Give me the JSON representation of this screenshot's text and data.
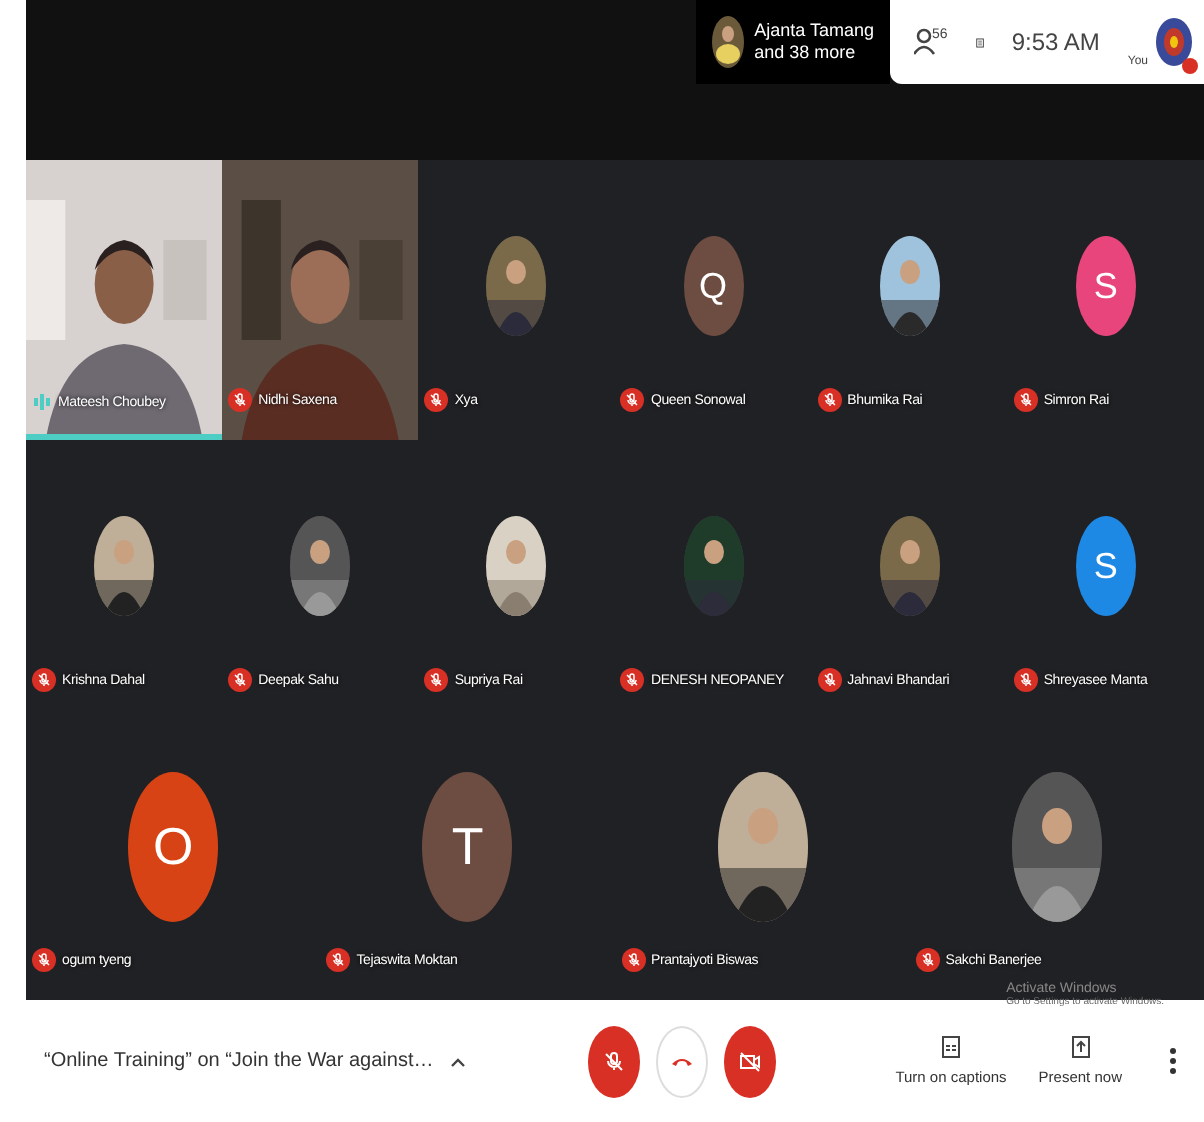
{
  "top_bar": {
    "presenter": {
      "name": "Ajanta Tamang",
      "more": "and 38 more"
    },
    "people_count": "56",
    "time": "9:53 AM",
    "self_label": "You",
    "self_muted": true
  },
  "rows": [
    [
      {
        "name": "Mateesh Choubey",
        "kind": "video",
        "muted": false,
        "speaking": true
      },
      {
        "name": "Nidhi Saxena",
        "kind": "video",
        "muted": true,
        "speaking": false
      },
      {
        "name": "Xya",
        "muted": true,
        "speaking": false
      },
      {
        "name": "Queen Sonowal",
        "kind": "letter",
        "letter": "Q",
        "color": "#6d4c41",
        "muted": true,
        "speaking": false
      },
      {
        "name": "Bhumika Rai",
        "muted": true,
        "speaking": false
      },
      {
        "name": "Simron Rai",
        "kind": "letter",
        "letter": "S",
        "color": "#e8457c",
        "muted": true,
        "speaking": false
      }
    ],
    [
      {
        "name": "Krishna Dahal",
        "muted": true,
        "speaking": false
      },
      {
        "name": "Deepak Sahu",
        "muted": true,
        "speaking": false
      },
      {
        "name": "Supriya Rai",
        "muted": true,
        "speaking": false
      },
      {
        "name": "DENESH NEOPANEY",
        "muted": true,
        "speaking": false
      },
      {
        "name": "Jahnavi Bhandari",
        "muted": true,
        "speaking": false
      },
      {
        "name": "Shreyasee Manta",
        "kind": "letter",
        "letter": "S",
        "color": "#1e88e5",
        "muted": true,
        "speaking": false
      }
    ],
    [
      {
        "name": "ogum tyeng",
        "kind": "letter",
        "letter": "O",
        "color": "#d84315",
        "muted": true,
        "speaking": false
      },
      {
        "name": "Tejaswita Moktan",
        "kind": "letter",
        "letter": "T",
        "color": "#6d4c41",
        "muted": true,
        "speaking": false
      },
      {
        "name": "Prantajyoti Biswas",
        "muted": true,
        "speaking": false
      },
      {
        "name": "Sakchi Banerjee",
        "muted": true,
        "speaking": false
      }
    ]
  ],
  "os_notice": {
    "title": "Activate Windows",
    "detail": "Go to Settings to activate Windows."
  },
  "meeting_title": "“Online Training” on “Join the War against…",
  "controls": [
    {
      "kind": "mic",
      "on": false
    },
    {
      "kind": "hangup"
    },
    {
      "kind": "camera",
      "on": false
    }
  ],
  "actions": [
    {
      "kind": "captions",
      "label": "Turn on captions"
    },
    {
      "kind": "present",
      "label": "Present now"
    }
  ]
}
